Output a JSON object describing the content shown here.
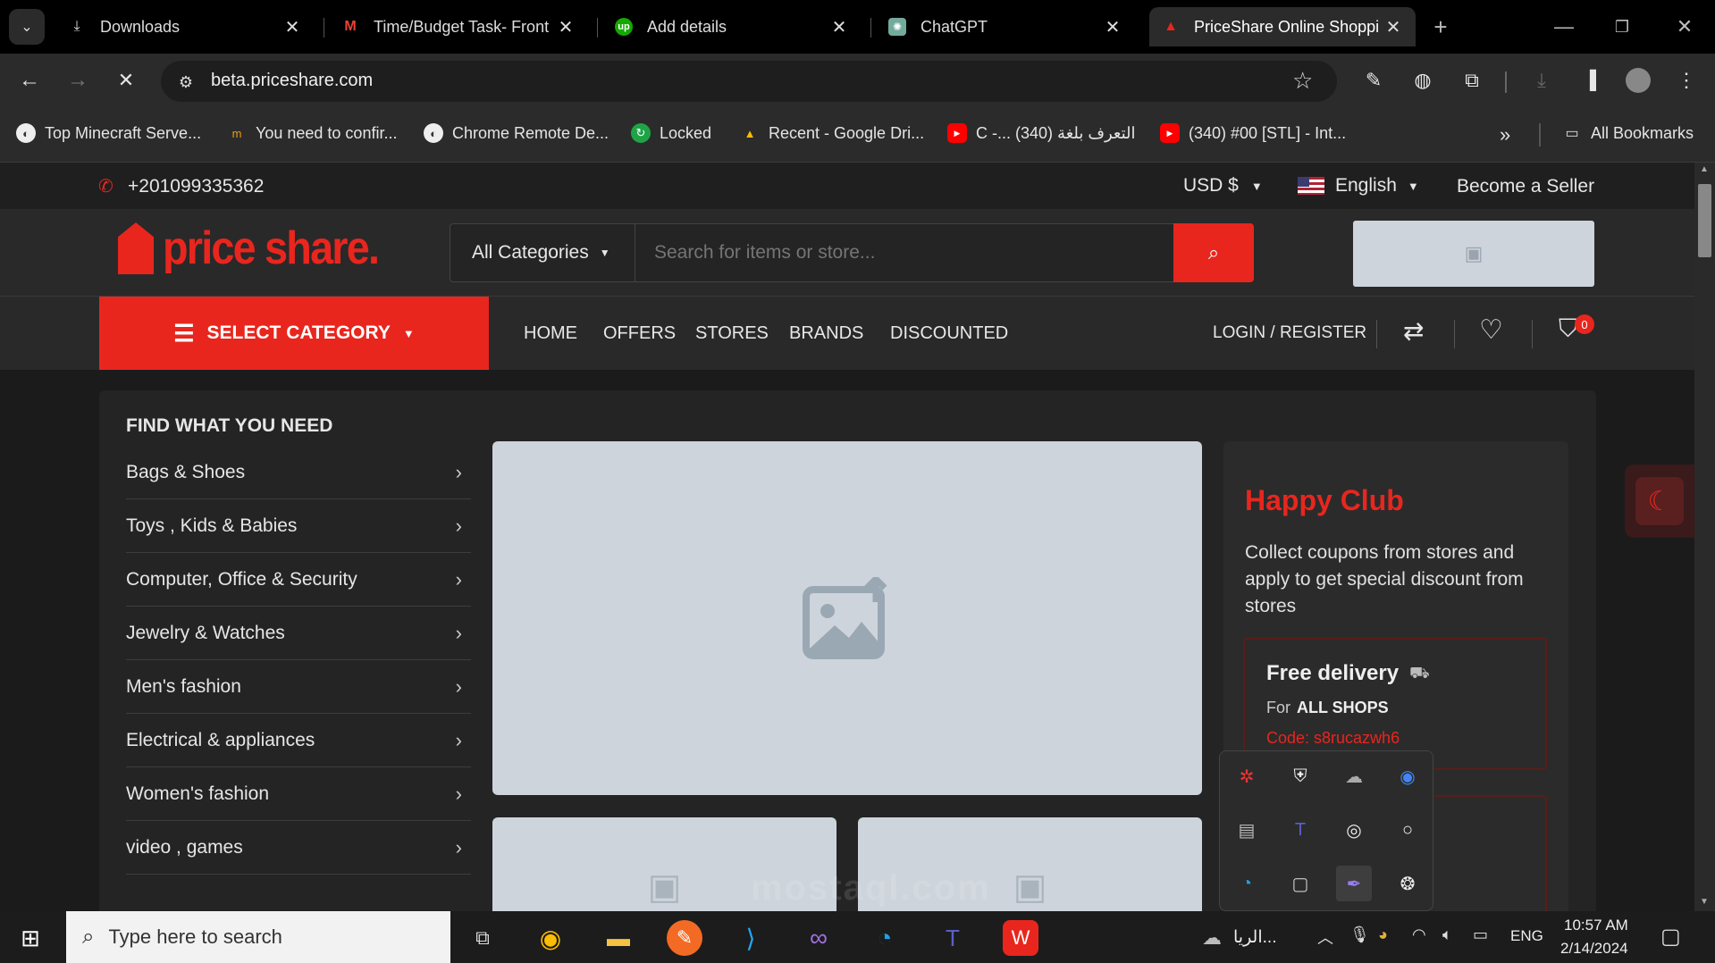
{
  "browser": {
    "tabs": [
      {
        "title": "Downloads",
        "icon": "download-icon"
      },
      {
        "title": "Time/Budget Task- Front",
        "icon": "gmail-icon"
      },
      {
        "title": "Add details",
        "icon": "upwork-icon"
      },
      {
        "title": "ChatGPT",
        "icon": "chatgpt-icon"
      },
      {
        "title": "PriceShare Online Shoppi",
        "icon": "priceshare-icon"
      }
    ],
    "url": "beta.priceshare.com",
    "bookmarks": [
      {
        "label": "Top Minecraft Serve...",
        "icon": "globe-icon"
      },
      {
        "label": "You need to confir...",
        "icon": "mostaql-icon"
      },
      {
        "label": "Chrome Remote De...",
        "icon": "globe-icon"
      },
      {
        "label": "Locked",
        "icon": "refresh-icon"
      },
      {
        "label": "Recent - Google Dri...",
        "icon": "drive-icon"
      },
      {
        "label": "C -... التعرف بلغة (340)",
        "icon": "youtube-icon"
      },
      {
        "label": "(340) #00 [STL] - Int...",
        "icon": "youtube-icon"
      }
    ],
    "all_bookmarks": "All Bookmarks"
  },
  "site": {
    "phone": "+201099335362",
    "currency": "USD $",
    "language": "English",
    "become_seller": "Become a Seller",
    "logo_text": "price share.",
    "search": {
      "category": "All Categories",
      "placeholder": "Search for items or store..."
    },
    "select_category": "SELECT CATEGORY",
    "nav": [
      "HOME",
      "OFFERS",
      "STORES",
      "BRANDS",
      "DISCOUNTED"
    ],
    "login": "LOGIN / REGISTER",
    "cart_count": "0",
    "sidebar_title": "FIND WHAT YOU NEED",
    "categories": [
      "Bags & Shoes",
      "Toys , Kids & Babies",
      "Computer, Office & Security",
      "Jewelry & Watches",
      "Men's fashion",
      "Electrical & appliances",
      "Women's fashion",
      "video , games"
    ],
    "club": {
      "title": "Happy Club",
      "desc": "Collect coupons from stores and apply to get special discount from stores",
      "coupon_title": "Free delivery",
      "coupon_for": "For",
      "coupon_shops": "ALL SHOPS",
      "coupon_code": "Code: s8rucazwh6"
    }
  },
  "taskbar": {
    "search_placeholder": "Type here to search",
    "weather": "الريا...",
    "lang": "ENG",
    "time": "10:57 AM",
    "date": "2/14/2024",
    "watermark": "mostaql.com"
  },
  "colors": {
    "accent": "#e8261e",
    "bg": "#1b1b1b"
  }
}
